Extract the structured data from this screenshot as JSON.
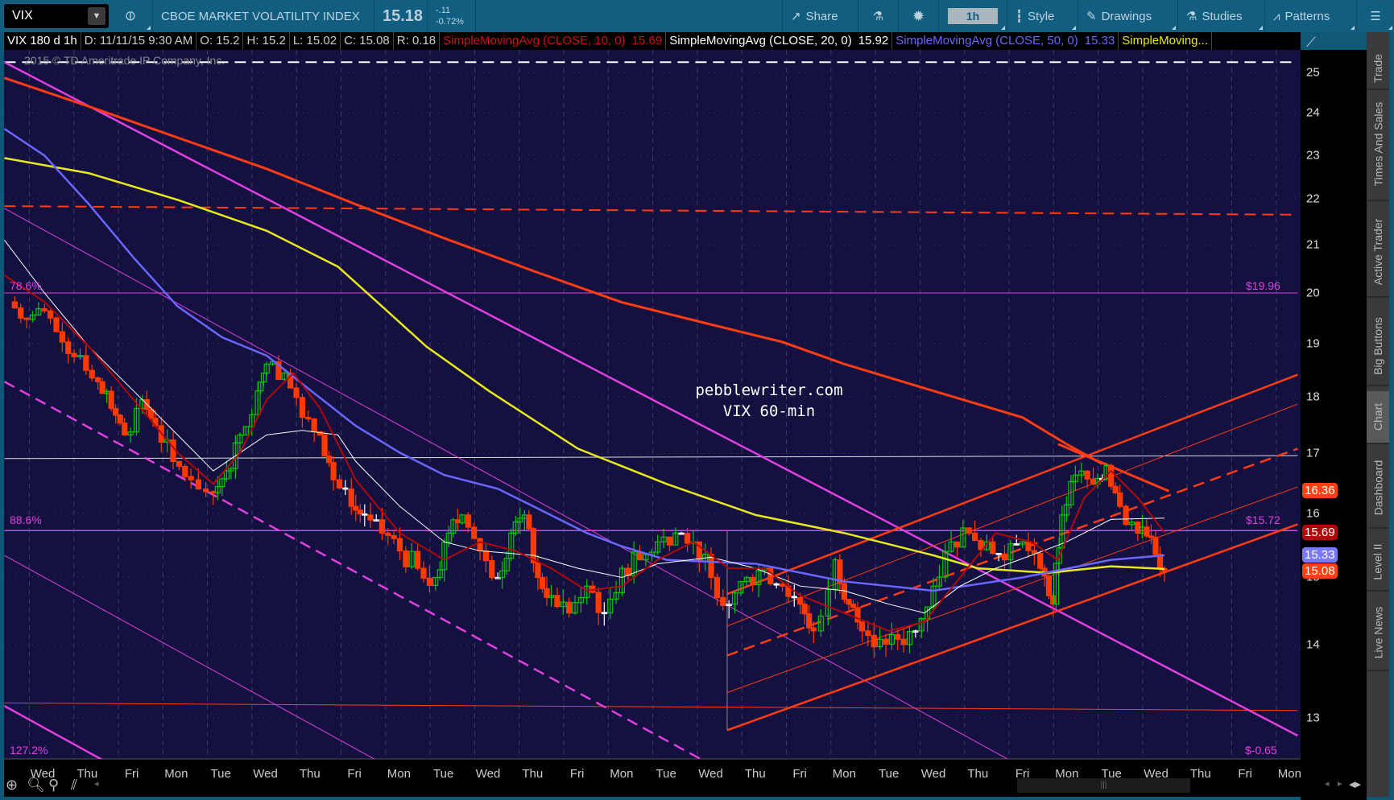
{
  "toolbar": {
    "symbol": "VIX",
    "description": "CBOE MARKET VOLATILITY INDEX",
    "last": "15.18",
    "change": "-.11",
    "change_pct": "-0.72%",
    "share": "Share",
    "timeframe": "1h",
    "style": "Style",
    "drawings": "Drawings",
    "studies": "Studies",
    "patterns": "Patterns"
  },
  "infobar": {
    "spec": "VIX 180 d 1h",
    "date": "D: 11/11/15 9:30 AM",
    "open": "O: 15.2",
    "high": "H: 15.2",
    "low": "L: 15.02",
    "close": "C: 15.08",
    "range": "R: 0.18",
    "sma10": "SimpleMovingAvg (CLOSE, 10, 0)",
    "sma10_val": "15.69",
    "sma20": "SimpleMovingAvg (CLOSE, 20, 0)",
    "sma20_val": "15.92",
    "sma50": "SimpleMovingAvg (CLOSE, 50, 0)",
    "sma50_val": "15.33",
    "sma100": "SimpleMoving..."
  },
  "copyright": "2015 © TD Ameritrade IP Company, Inc.",
  "watermark": {
    "line1": "pebblewriter.com",
    "line2": "VIX 60-min"
  },
  "fib_labels": {
    "f786": "78.6%",
    "f786_price": "$19.96",
    "f886": "88.6%",
    "f886_price": "$15.72",
    "f1272": "127.2%",
    "f1272_price": "$-0.65"
  },
  "price_labels": [
    {
      "text": "16.36",
      "value": 16.36,
      "color": "#ff4012"
    },
    {
      "text": "15.69",
      "value": 15.69,
      "color": "#b00808"
    },
    {
      "text": "15.33",
      "value": 15.33,
      "color": "#7a78ff"
    },
    {
      "text": "15.08",
      "value": 15.08,
      "color": "#ff4012"
    }
  ],
  "side_tabs": [
    {
      "label": "Trade"
    },
    {
      "label": "Times And Sales"
    },
    {
      "label": "Active Trader"
    },
    {
      "label": "Big Buttons"
    },
    {
      "label": "Chart",
      "active": true
    },
    {
      "label": "Dashboard"
    },
    {
      "label": "Level II"
    },
    {
      "label": "Live News"
    }
  ],
  "chart_data": {
    "type": "candlestick",
    "y_scale": "log",
    "ylim": [
      12.4,
      25.6
    ],
    "y_ticks": [
      13,
      14,
      15,
      16,
      17,
      18,
      19,
      20,
      21,
      22,
      23,
      24,
      25
    ],
    "x_labels": [
      "Wed",
      "Thu",
      "Fri",
      "Mon",
      "Tue",
      "Wed",
      "Thu",
      "Fri",
      "Mon",
      "Tue",
      "Wed",
      "Thu",
      "Fri",
      "Mon",
      "Tue",
      "Wed",
      "Thu",
      "Fri",
      "Mon",
      "Tue",
      "Wed",
      "Thu",
      "Fri",
      "Mon",
      "Tue",
      "Wed",
      "Thu",
      "Fri",
      "Mon"
    ],
    "closes": [
      [
        -0.76,
        19.82
      ],
      [
        -0.36,
        19.47
      ],
      [
        0.04,
        19.64
      ],
      [
        0.44,
        19.03
      ],
      [
        0.84,
        18.77
      ],
      [
        1.24,
        18.28
      ],
      [
        1.54,
        17.79
      ],
      [
        1.84,
        17.32
      ],
      [
        2.24,
        17.95
      ],
      [
        2.53,
        17.48
      ],
      [
        2.93,
        16.86
      ],
      [
        3.33,
        16.55
      ],
      [
        3.83,
        16.33
      ],
      [
        4.13,
        16.7
      ],
      [
        4.43,
        17.32
      ],
      [
        4.83,
        18.11
      ],
      [
        5.03,
        18.61
      ],
      [
        5.43,
        18.44
      ],
      [
        5.83,
        17.63
      ],
      [
        6.23,
        17.32
      ],
      [
        6.53,
        16.55
      ],
      [
        6.93,
        16.11
      ],
      [
        7.23,
        15.97
      ],
      [
        7.62,
        15.68
      ],
      [
        8.02,
        15.4
      ],
      [
        8.42,
        15.13
      ],
      [
        8.82,
        14.99
      ],
      [
        9.12,
        15.68
      ],
      [
        9.42,
        15.97
      ],
      [
        9.82,
        15.4
      ],
      [
        10.22,
        14.99
      ],
      [
        10.52,
        15.68
      ],
      [
        10.82,
        15.97
      ],
      [
        11.12,
        14.99
      ],
      [
        11.42,
        14.72
      ],
      [
        11.82,
        14.46
      ],
      [
        12.22,
        14.86
      ],
      [
        12.61,
        14.46
      ],
      [
        13.01,
        15.13
      ],
      [
        13.41,
        15.26
      ],
      [
        13.81,
        15.54
      ],
      [
        14.21,
        15.68
      ],
      [
        14.61,
        15.54
      ],
      [
        15.01,
        14.99
      ],
      [
        15.41,
        14.59
      ],
      [
        15.81,
        14.99
      ],
      [
        16.21,
        15.13
      ],
      [
        16.61,
        14.86
      ],
      [
        17.01,
        14.59
      ],
      [
        17.31,
        14.2
      ],
      [
        17.8,
        15.26
      ],
      [
        18.1,
        14.59
      ],
      [
        18.4,
        14.2
      ],
      [
        18.8,
        14.08
      ],
      [
        19.2,
        14.08
      ],
      [
        19.6,
        14.2
      ],
      [
        20.0,
        14.86
      ],
      [
        20.4,
        15.54
      ],
      [
        20.8,
        15.68
      ],
      [
        21.2,
        15.54
      ],
      [
        21.6,
        15.26
      ],
      [
        22.0,
        15.54
      ],
      [
        22.4,
        15.13
      ],
      [
        22.69,
        14.59
      ],
      [
        22.89,
        15.97
      ],
      [
        23.19,
        16.63
      ],
      [
        23.59,
        16.48
      ],
      [
        23.89,
        16.79
      ],
      [
        24.19,
        16.11
      ],
      [
        24.59,
        15.68
      ],
      [
        24.89,
        15.61
      ],
      [
        25.19,
        15.08
      ]
    ],
    "series": [
      {
        "name": "SMA 200",
        "color": "#ff3c14",
        "width": 3,
        "points": [
          [
            -0.86,
            24.87
          ],
          [
            1.04,
            24.16
          ],
          [
            3.03,
            23.41
          ],
          [
            5.03,
            22.68
          ],
          [
            7.03,
            21.88
          ],
          [
            9.02,
            21.14
          ],
          [
            11.02,
            20.45
          ],
          [
            13.01,
            19.81
          ],
          [
            15.01,
            19.37
          ],
          [
            16.61,
            19.03
          ],
          [
            18.0,
            18.61
          ],
          [
            20.0,
            18.11
          ],
          [
            22.0,
            17.63
          ],
          [
            22.99,
            17.16
          ],
          [
            23.79,
            16.82
          ]
        ]
      },
      {
        "name": "SMA 100",
        "color": "#e8e820",
        "width": 2.5,
        "points": [
          [
            -0.86,
            22.93
          ],
          [
            1.04,
            22.58
          ],
          [
            3.03,
            21.98
          ],
          [
            5.03,
            21.3
          ],
          [
            6.63,
            20.54
          ],
          [
            7.62,
            19.73
          ],
          [
            8.62,
            18.94
          ],
          [
            10.02,
            18.11
          ],
          [
            12.02,
            17.08
          ],
          [
            14.01,
            16.48
          ],
          [
            16.01,
            15.97
          ],
          [
            18.0,
            15.68
          ],
          [
            20.0,
            15.33
          ],
          [
            21.0,
            15.13
          ],
          [
            22.59,
            15.06
          ],
          [
            23.99,
            15.16
          ],
          [
            25.19,
            15.12
          ]
        ]
      },
      {
        "name": "SMA 50",
        "color": "#6a66ff",
        "width": 2.5,
        "points": [
          [
            -0.86,
            23.62
          ],
          [
            0.04,
            22.99
          ],
          [
            1.04,
            21.88
          ],
          [
            2.04,
            20.73
          ],
          [
            3.03,
            19.73
          ],
          [
            4.03,
            19.12
          ],
          [
            5.03,
            18.77
          ],
          [
            6.03,
            18.11
          ],
          [
            7.03,
            17.48
          ],
          [
            8.02,
            17.01
          ],
          [
            9.02,
            16.63
          ],
          [
            10.22,
            16.4
          ],
          [
            11.02,
            16.11
          ],
          [
            12.22,
            15.68
          ],
          [
            13.01,
            15.47
          ],
          [
            14.01,
            15.26
          ],
          [
            16.01,
            15.2
          ],
          [
            18.0,
            14.93
          ],
          [
            20.0,
            14.79
          ],
          [
            22.0,
            14.99
          ],
          [
            23.99,
            15.26
          ],
          [
            25.19,
            15.33
          ]
        ]
      },
      {
        "name": "SMA 20",
        "color": "#ffffff",
        "width": 1,
        "points": [
          [
            -0.86,
            21.1
          ],
          [
            0.04,
            20.0
          ],
          [
            1.04,
            18.94
          ],
          [
            2.04,
            18.11
          ],
          [
            3.03,
            17.32
          ],
          [
            3.83,
            16.7
          ],
          [
            4.43,
            17.01
          ],
          [
            5.03,
            17.32
          ],
          [
            5.83,
            17.4
          ],
          [
            6.63,
            17.32
          ],
          [
            7.03,
            16.86
          ],
          [
            8.02,
            16.11
          ],
          [
            9.02,
            15.54
          ],
          [
            9.82,
            15.4
          ],
          [
            11.02,
            15.33
          ],
          [
            12.02,
            15.13
          ],
          [
            13.01,
            14.99
          ],
          [
            13.81,
            15.2
          ],
          [
            15.01,
            15.3
          ],
          [
            16.01,
            15.13
          ],
          [
            17.01,
            14.86
          ],
          [
            18.0,
            14.79
          ],
          [
            19.0,
            14.59
          ],
          [
            19.8,
            14.46
          ],
          [
            20.6,
            14.86
          ],
          [
            21.4,
            15.13
          ],
          [
            22.2,
            15.33
          ],
          [
            22.99,
            15.54
          ],
          [
            23.99,
            15.9
          ],
          [
            25.19,
            15.92
          ]
        ]
      },
      {
        "name": "SMA 10",
        "color": "#b00808",
        "width": 2,
        "points": [
          [
            -0.86,
            20.36
          ],
          [
            0.04,
            19.82
          ],
          [
            1.04,
            18.94
          ],
          [
            2.04,
            17.95
          ],
          [
            3.03,
            17.01
          ],
          [
            3.83,
            16.48
          ],
          [
            4.43,
            17.01
          ],
          [
            5.03,
            17.95
          ],
          [
            5.63,
            18.44
          ],
          [
            6.23,
            17.79
          ],
          [
            7.03,
            16.55
          ],
          [
            8.02,
            15.68
          ],
          [
            9.02,
            15.26
          ],
          [
            9.82,
            15.54
          ],
          [
            10.62,
            15.4
          ],
          [
            11.42,
            15.13
          ],
          [
            12.22,
            14.79
          ],
          [
            13.01,
            14.86
          ],
          [
            13.81,
            15.26
          ],
          [
            14.61,
            15.54
          ],
          [
            15.41,
            15.13
          ],
          [
            16.21,
            15.13
          ],
          [
            17.01,
            14.72
          ],
          [
            18.0,
            14.46
          ],
          [
            19.0,
            14.2
          ],
          [
            19.8,
            14.33
          ],
          [
            20.6,
            14.99
          ],
          [
            21.4,
            15.68
          ],
          [
            22.2,
            15.54
          ],
          [
            22.79,
            15.26
          ],
          [
            23.39,
            16.25
          ],
          [
            23.99,
            16.7
          ],
          [
            24.59,
            16.25
          ],
          [
            25.19,
            15.69
          ]
        ]
      }
    ],
    "drawings": [
      {
        "name": "top-dashed-white",
        "color": "#ffffff",
        "width": 2,
        "dash": "14 8",
        "from": [
          -0.86,
          25.27
        ],
        "to": [
          28.18,
          25.27
        ]
      },
      {
        "name": "red-dashed-horizontal",
        "color": "#ff3c14",
        "width": 2,
        "dash": "14 8",
        "from": [
          -0.86,
          21.84
        ],
        "to": [
          28.18,
          21.65
        ]
      },
      {
        "name": "fib-78.6",
        "color": "#e040e0",
        "width": 1,
        "from": [
          -0.86,
          20.0
        ],
        "to": [
          28.18,
          20.0
        ]
      },
      {
        "name": "white-horizontal",
        "color": "#dddddd",
        "width": 1,
        "from": [
          -0.86,
          16.91
        ],
        "to": [
          28.18,
          16.96
        ]
      },
      {
        "name": "fib-88.6",
        "color": "#e040e0",
        "width": 1.5,
        "from": [
          -0.86,
          15.72
        ],
        "to": [
          28.18,
          15.72
        ]
      },
      {
        "name": "red-thin-horizontal",
        "color": "#ff3c14",
        "width": 1,
        "from": [
          -0.86,
          13.2
        ],
        "to": [
          28.18,
          13.1
        ]
      },
      {
        "name": "magenta-channel-top",
        "color": "#e040e0",
        "width": 2.5,
        "from": [
          -0.86,
          25.27
        ],
        "to": [
          28.18,
          12.77
        ]
      },
      {
        "name": "magenta-thin-1",
        "color": "#e040e0",
        "width": 1,
        "from": [
          -0.86,
          21.79
        ],
        "to": [
          21.7,
          12.46
        ]
      },
      {
        "name": "magenta-dashed",
        "color": "#e040e0",
        "width": 2.5,
        "dash": "14 8",
        "from": [
          -0.86,
          18.28
        ],
        "to": [
          14.81,
          12.46
        ]
      },
      {
        "name": "magenta-thin-2",
        "color": "#e040e0",
        "width": 1,
        "from": [
          -0.86,
          15.33
        ],
        "to": [
          7.48,
          12.46
        ]
      },
      {
        "name": "magenta-channel-bottom",
        "color": "#e040e0",
        "width": 2.5,
        "from": [
          -0.86,
          13.16
        ],
        "to": [
          1.34,
          12.46
        ]
      },
      {
        "name": "red-channel-bottom",
        "color": "#ff3c14",
        "width": 2.5,
        "from": [
          15.37,
          12.84
        ],
        "to": [
          28.18,
          15.82
        ]
      },
      {
        "name": "red-channel-top",
        "color": "#ff3c14",
        "width": 2.5,
        "from": [
          15.37,
          14.74
        ],
        "to": [
          28.18,
          18.41
        ]
      },
      {
        "name": "red-channel-mid",
        "color": "#ff3c14",
        "width": 2.5,
        "dash": "14 8",
        "from": [
          15.37,
          13.85
        ],
        "to": [
          28.18,
          17.08
        ]
      },
      {
        "name": "red-channel-thin-upper",
        "color": "#ff3c14",
        "width": 1,
        "from": [
          15.37,
          14.27
        ],
        "to": [
          28.18,
          17.87
        ]
      },
      {
        "name": "red-channel-thin-lower",
        "color": "#ff3c14",
        "width": 1,
        "from": [
          15.37,
          13.34
        ],
        "to": [
          28.18,
          16.43
        ]
      },
      {
        "name": "red-resistance",
        "color": "#ff3c14",
        "width": 3,
        "from": [
          22.8,
          17.16
        ],
        "to": [
          25.29,
          16.36
        ]
      },
      {
        "name": "channel-anchor-vertical",
        "color": "#888888",
        "width": 1,
        "from": [
          15.37,
          15.72
        ],
        "to": [
          15.37,
          12.84
        ]
      }
    ]
  }
}
